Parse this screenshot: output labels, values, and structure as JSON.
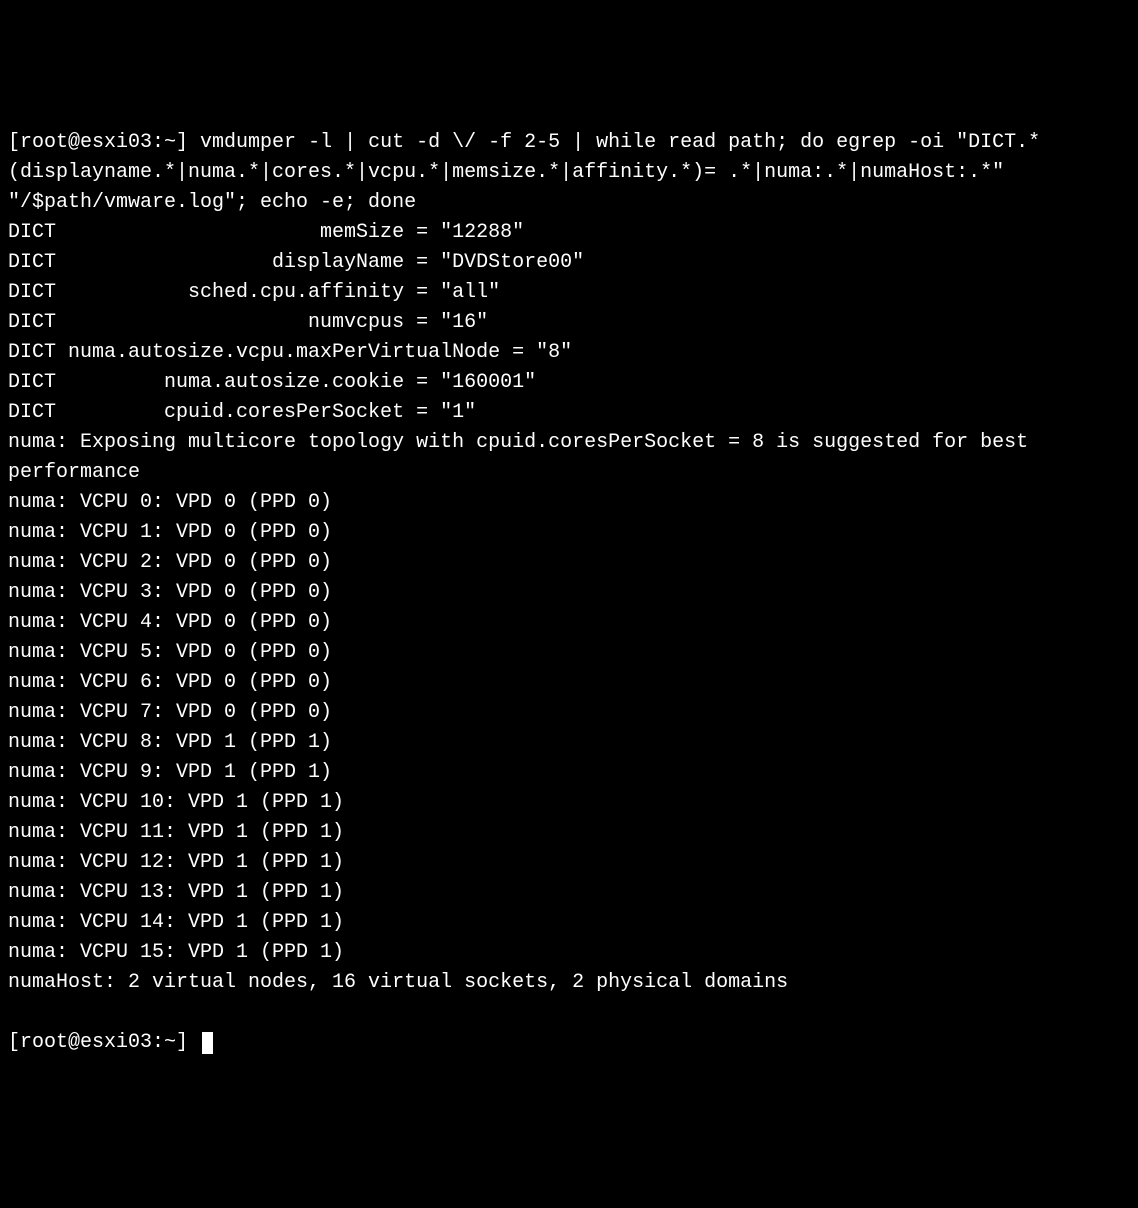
{
  "prompt1": "[root@esxi03:~]",
  "command": "vmdumper -l | cut -d \\/ -f 2-5 | while read path; do egrep -oi \"DICT.*(displayname.*|numa.*|cores.*|vcpu.*|memsize.*|affinity.*)= .*|numa:.*|numaHost:.*\" \"/$path/vmware.log\"; echo -e; done",
  "dict_lines": [
    "DICT                      memSize = \"12288\"",
    "DICT                  displayName = \"DVDStore00\"",
    "DICT           sched.cpu.affinity = \"all\"",
    "DICT                     numvcpus = \"16\"",
    "DICT numa.autosize.vcpu.maxPerVirtualNode = \"8\"",
    "DICT         numa.autosize.cookie = \"160001\"",
    "DICT         cpuid.coresPerSocket = \"1\""
  ],
  "numa_suggestion": "numa: Exposing multicore topology with cpuid.coresPerSocket = 8 is suggested for best performance",
  "numa_vcpu_lines": [
    "numa: VCPU 0: VPD 0 (PPD 0)",
    "numa: VCPU 1: VPD 0 (PPD 0)",
    "numa: VCPU 2: VPD 0 (PPD 0)",
    "numa: VCPU 3: VPD 0 (PPD 0)",
    "numa: VCPU 4: VPD 0 (PPD 0)",
    "numa: VCPU 5: VPD 0 (PPD 0)",
    "numa: VCPU 6: VPD 0 (PPD 0)",
    "numa: VCPU 7: VPD 0 (PPD 0)",
    "numa: VCPU 8: VPD 1 (PPD 1)",
    "numa: VCPU 9: VPD 1 (PPD 1)",
    "numa: VCPU 10: VPD 1 (PPD 1)",
    "numa: VCPU 11: VPD 1 (PPD 1)",
    "numa: VCPU 12: VPD 1 (PPD 1)",
    "numa: VCPU 13: VPD 1 (PPD 1)",
    "numa: VCPU 14: VPD 1 (PPD 1)",
    "numa: VCPU 15: VPD 1 (PPD 1)"
  ],
  "numa_host_line": "numaHost: 2 virtual nodes, 16 virtual sockets, 2 physical domains",
  "prompt2": "[root@esxi03:~]"
}
